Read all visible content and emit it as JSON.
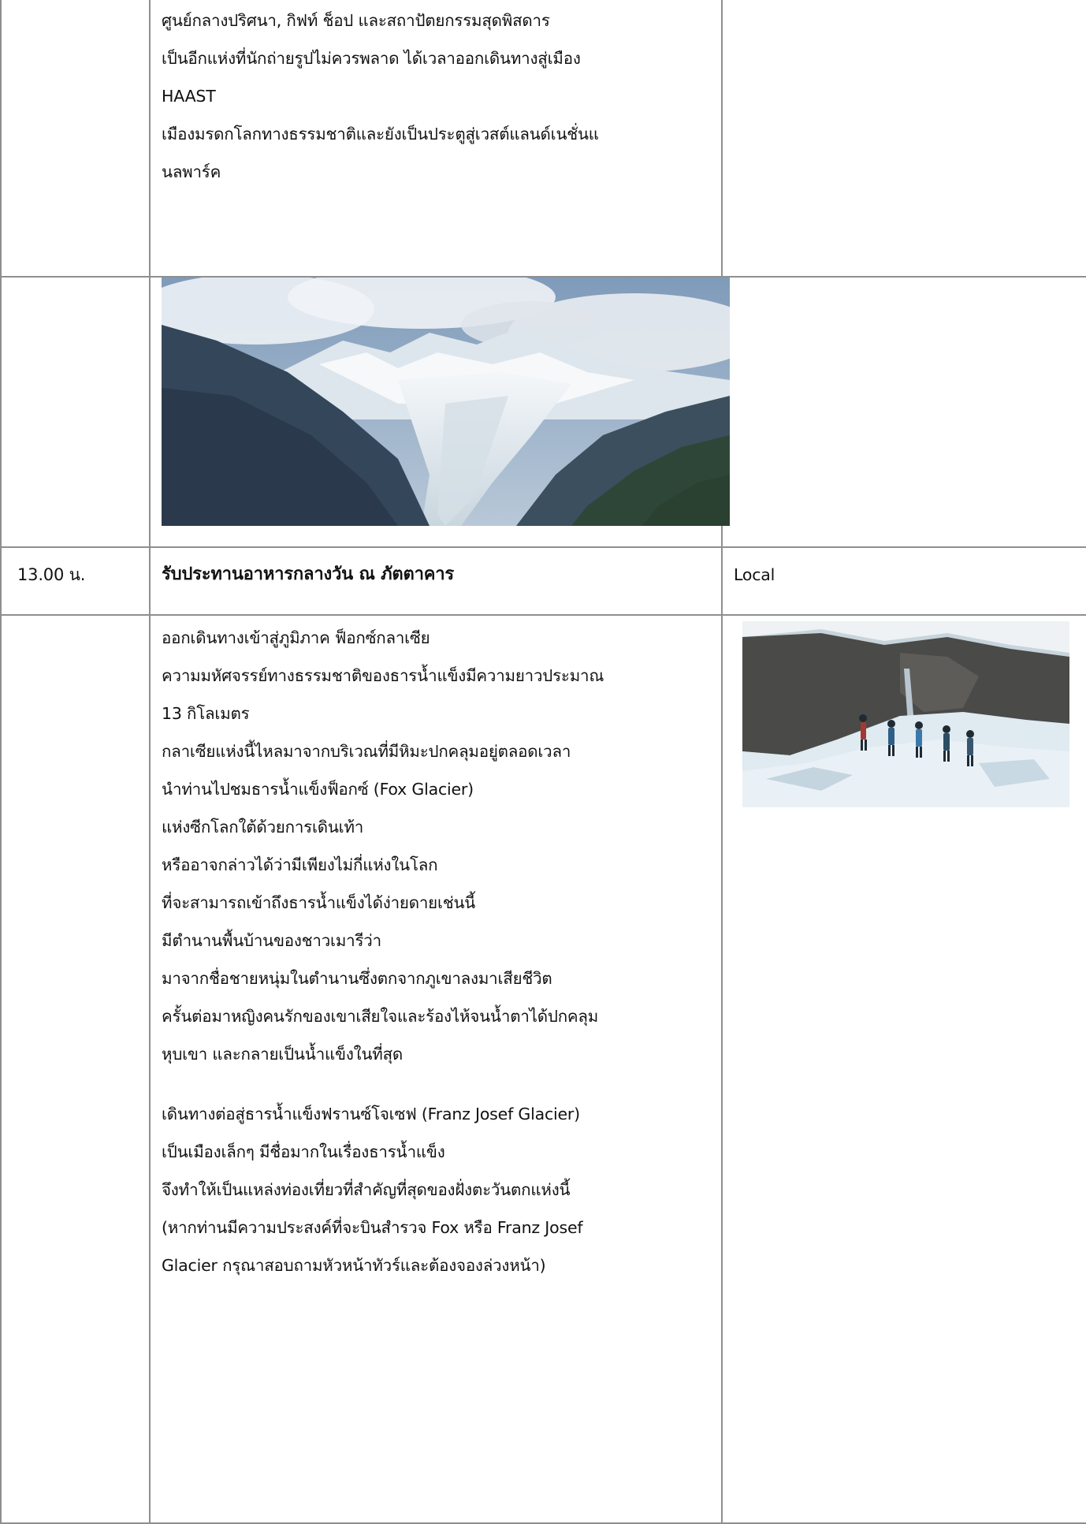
{
  "intro": {
    "lines": [
      "ศูนย์กลางปริศนา, กิฟท์ ช็อป และสถาปัตยกรรมสุดพิสดาร",
      "เป็นอีกแห่งที่นักถ่ายรูปไม่ควรพลาด ได้เวลาออกเดินทางสู่เมือง",
      "HAAST",
      "เมืองมรดกโลกทางธรรมชาติและยังเป็นประตูสู่เวสต์แลนด์เนชั่นแ",
      "นลพาร์ค"
    ]
  },
  "lunch": {
    "time": "13.00 น.",
    "title": "รับประทานอาหารกลางวัน ณ ภัตตาคาร",
    "meal": "Local"
  },
  "fox_glacier": {
    "lines": [
      "ออกเดินทางเข้าสู่ภูมิภาค ฟ็อกซ์กลาเซีย",
      "ความมหัศจรรย์ทางธรรมชาติของธารน้ำแข็งมีความยาวประมาณ",
      "13 กิโลเมตร",
      "กลาเซียแห่งนี้ไหลมาจากบริเวณที่มีหิมะปกคลุมอยู่ตลอดเวลา",
      "นำท่านไปชมธารน้ำแข็งฟ็อกซ์ (Fox Glacier)",
      "แห่งซีกโลกใต้ด้วยการเดินเท้า",
      "หรืออาจกล่าวได้ว่ามีเพียงไม่กี่แห่งในโลก",
      "ที่จะสามารถเข้าถึงธารน้ำแข็งได้ง่ายดายเช่นนี้",
      "มีตำนานพื้นบ้านของชาวเมารีว่า",
      "มาจากชื่อชายหนุ่มในตำนานซึ่งตกจากภูเขาลงมาเสียชีวิต",
      "ครั้นต่อมาหญิงคนรักของเขาเสียใจและร้องไห้จนน้ำตาได้ปกคลุม",
      "หุบเขา และกลายเป็นน้ำแข็งในที่สุด"
    ]
  },
  "franz_josef": {
    "lines": [
      "เดินทางต่อสู่ธารน้ำแข็งฟรานซ์โจเซฟ (Franz Josef Glacier)",
      "เป็นเมืองเล็กๆ มีชื่อมากในเรื่องธารน้ำแข็ง",
      "จึงทำให้เป็นแหล่งท่องเที่ยวที่สำคัญที่สุดของฝั่งตะวันตกแห่งนี้",
      "(หากท่านมีความประสงค์ที่จะบินสำรวจ Fox หรือ Franz Josef",
      "Glacier กรุณาสอบถามหัวหน้าทัวร์และต้องจองล่วงหน้า)"
    ]
  },
  "colors": {
    "border": "#8f8f8f",
    "text": "#111111",
    "sky": "#8fa7c2",
    "mountain_dark": "#2f3b4a",
    "ice": "#e9f0f5",
    "forest": "#2f4a3a"
  },
  "images": {
    "glacier_valley": "glacier-valley-photo",
    "hikers_on_glacier": "glacier-hikers-photo"
  }
}
